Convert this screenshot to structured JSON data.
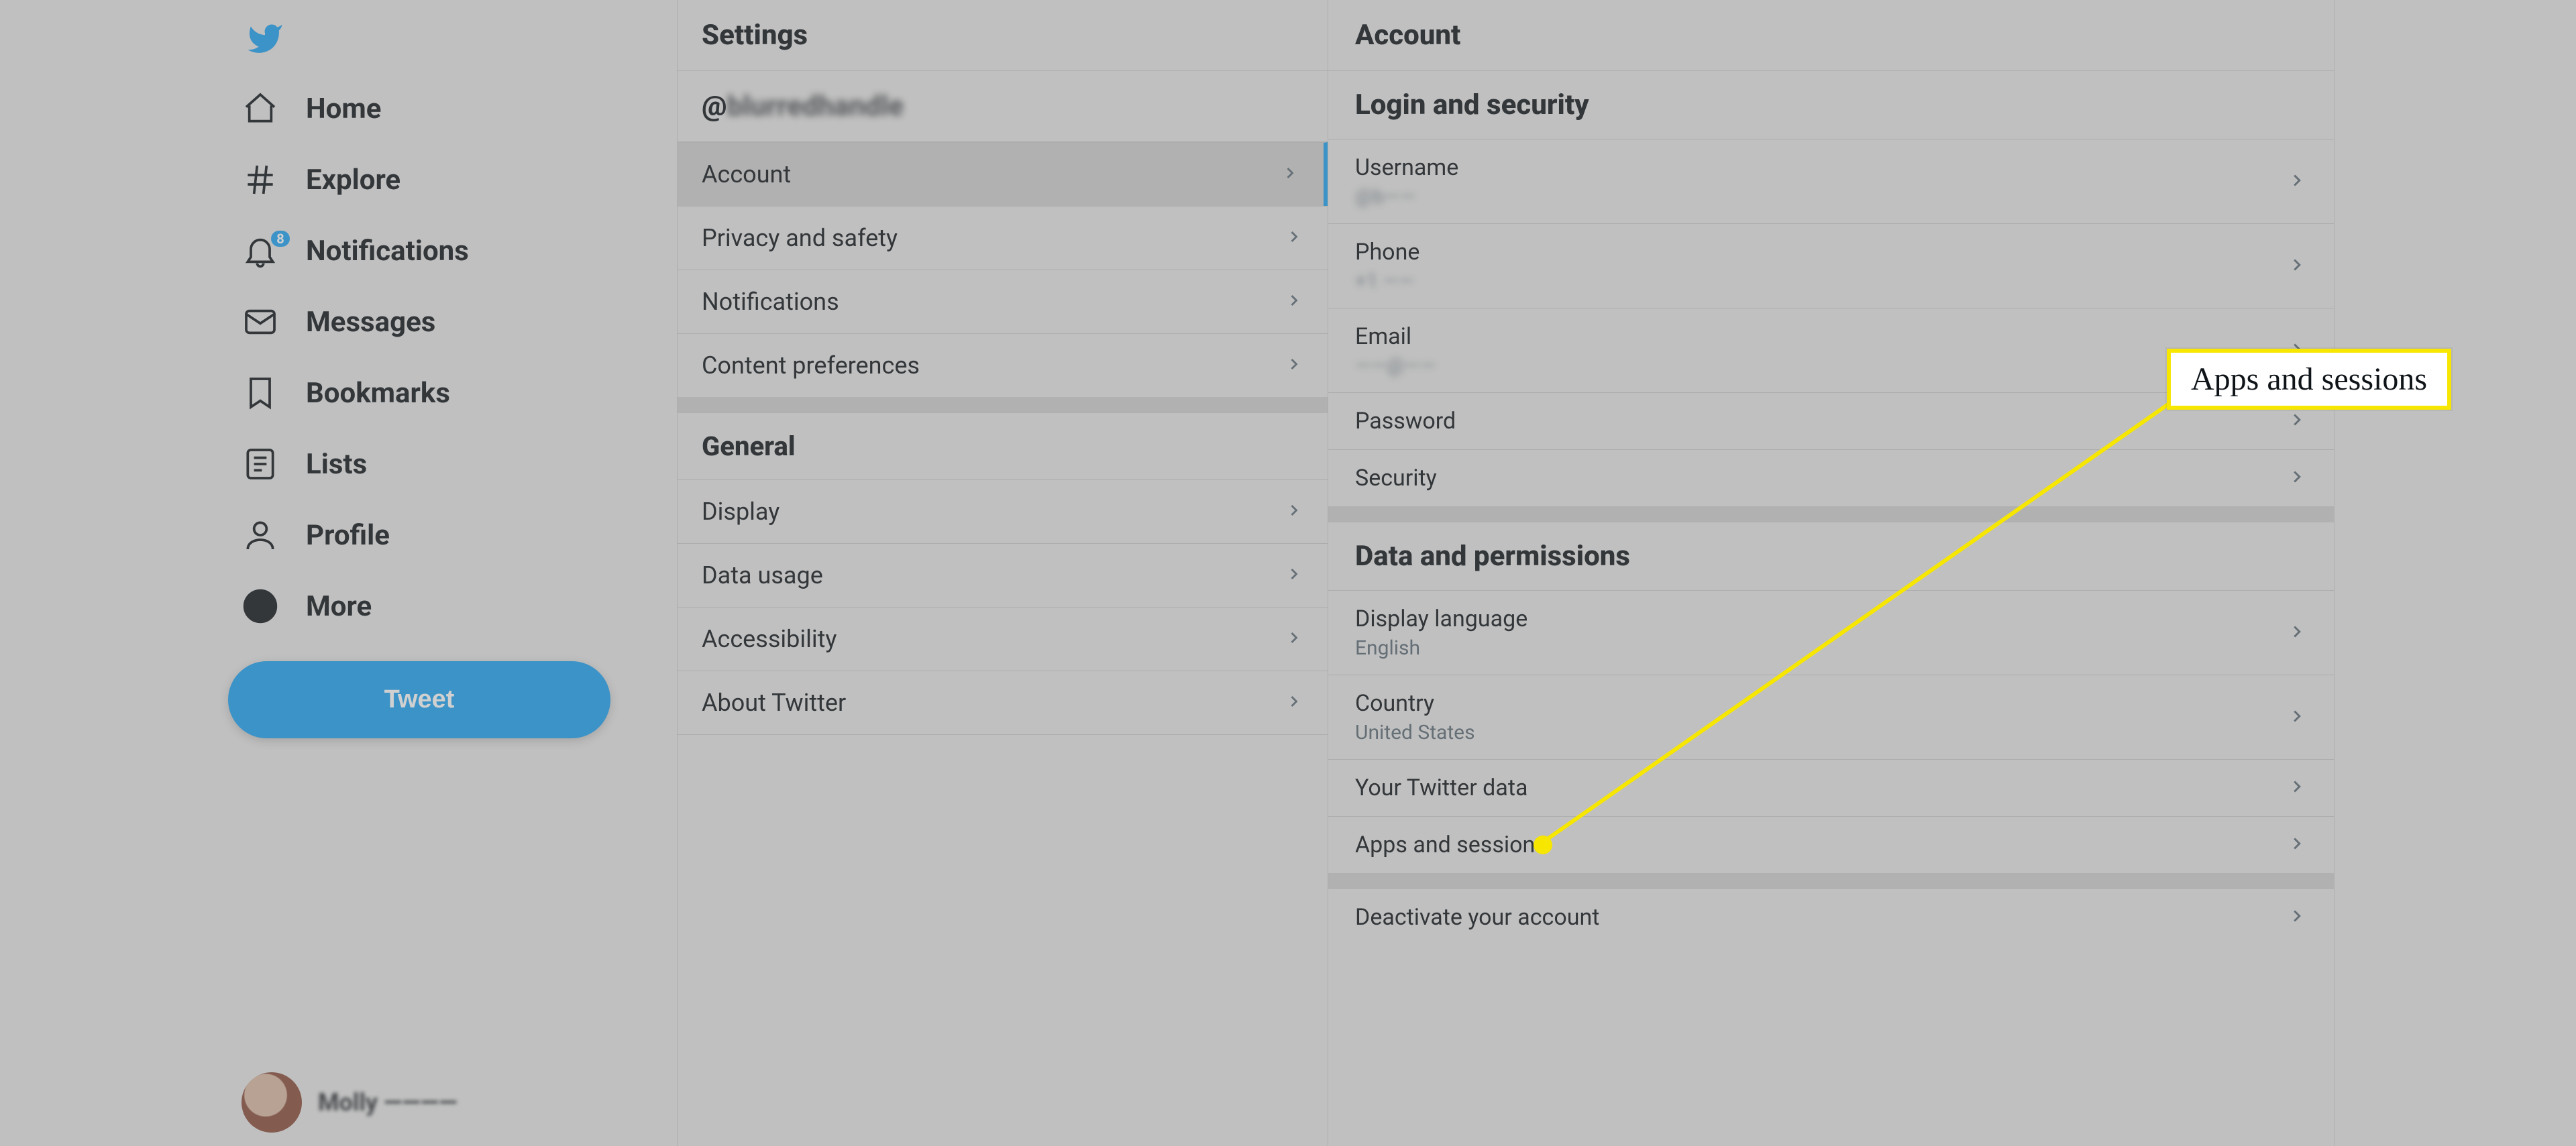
{
  "nav": {
    "home": "Home",
    "explore": "Explore",
    "notifications": "Notifications",
    "notifications_badge": "8",
    "messages": "Messages",
    "bookmarks": "Bookmarks",
    "lists": "Lists",
    "profile": "Profile",
    "more": "More",
    "tweet": "Tweet",
    "user_name": "Molly ————"
  },
  "settings": {
    "title": "Settings",
    "handle_prefix": "@",
    "handle_blur": "blurredhandle",
    "items_primary": {
      "account": "Account",
      "privacy": "Privacy and safety",
      "notifications": "Notifications",
      "content": "Content preferences"
    },
    "general_heading": "General",
    "items_general": {
      "display": "Display",
      "data_usage": "Data usage",
      "accessibility": "Accessibility",
      "about": "About Twitter"
    }
  },
  "account": {
    "title": "Account",
    "login_heading": "Login and security",
    "username_label": "Username",
    "username_value": "@b——",
    "phone_label": "Phone",
    "phone_value": "+1 ——",
    "email_label": "Email",
    "email_value": "——@——",
    "password_label": "Password",
    "security_label": "Security",
    "data_heading": "Data and permissions",
    "display_lang_label": "Display language",
    "display_lang_value": "English",
    "country_label": "Country",
    "country_value": "United States",
    "twitter_data_label": "Your Twitter data",
    "apps_sessions_label": "Apps and sessions",
    "deactivate_label": "Deactivate your account"
  },
  "callout": {
    "text": "Apps and sessions"
  }
}
